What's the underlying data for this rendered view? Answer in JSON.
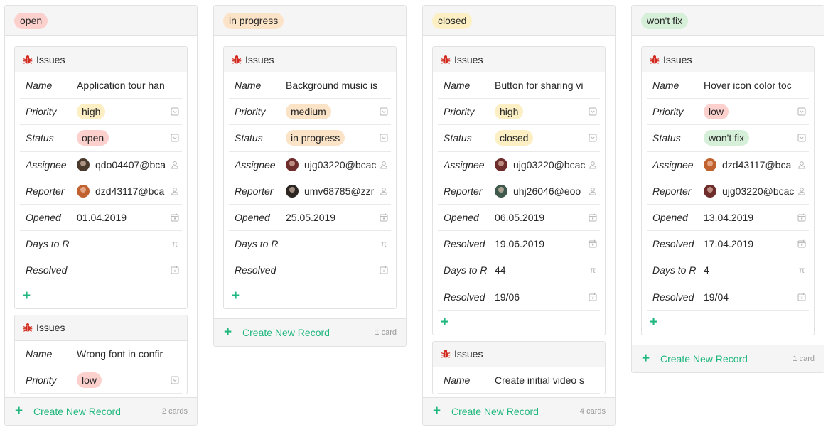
{
  "colors": {
    "open": "#fbd0cd",
    "in_progress": "#fbe3c8",
    "closed": "#fcefc4",
    "wont_fix": "#d5efd8",
    "high": "#fcefc4",
    "medium": "#fbe3c8",
    "low": "#fbd0cd",
    "accent": "#1eb77d"
  },
  "labels": {
    "card_title": "Issues",
    "name": "Name",
    "priority": "Priority",
    "status": "Status",
    "assignee": "Assignee",
    "reporter": "Reporter",
    "opened": "Opened",
    "days": "Days to R",
    "resolved": "Resolved",
    "create": "Create New Record",
    "add": "+"
  },
  "icons": [
    "bug-icon",
    "dropdown-icon",
    "user-icon",
    "calendar-icon",
    "pi-icon",
    "plus-icon"
  ],
  "columns": [
    {
      "status": "open",
      "count": "2 cards",
      "cards": [
        {
          "name": "Application tour han",
          "priority": "high",
          "status": "open",
          "assignee": "qdo04407@bca",
          "reporter": "dzd43117@bca",
          "opened": "01.04.2019",
          "resolved_date": "",
          "days": "",
          "resolved": ""
        },
        {
          "name": "Wrong font in confir",
          "priority": "low"
        }
      ]
    },
    {
      "status": "in progress",
      "count": "1 card",
      "cards": [
        {
          "name": "Background music is",
          "priority": "medium",
          "status": "in progress",
          "assignee": "ujg03220@bcac",
          "reporter": "umv68785@zzr",
          "opened": "25.05.2019",
          "days": "",
          "resolved": ""
        }
      ]
    },
    {
      "status": "closed",
      "count": "4 cards",
      "cards": [
        {
          "name": "Button for sharing vi",
          "priority": "high",
          "status": "closed",
          "assignee": "ujg03220@bcac",
          "reporter": "uhj26046@eoo",
          "opened": "06.05.2019",
          "resolved_date": "19.06.2019",
          "days": "44",
          "resolved": "19/06"
        },
        {
          "name": "Create initial video s"
        }
      ]
    },
    {
      "status": "won't fix",
      "count": "1 card",
      "cards": [
        {
          "name": "Hover icon color toc",
          "priority": "low",
          "status": "won't fix",
          "assignee": "dzd43117@bca",
          "reporter": "ujg03220@bcac",
          "opened": "13.04.2019",
          "resolved_date": "17.04.2019",
          "days": "4",
          "resolved": "19/04"
        }
      ]
    }
  ]
}
